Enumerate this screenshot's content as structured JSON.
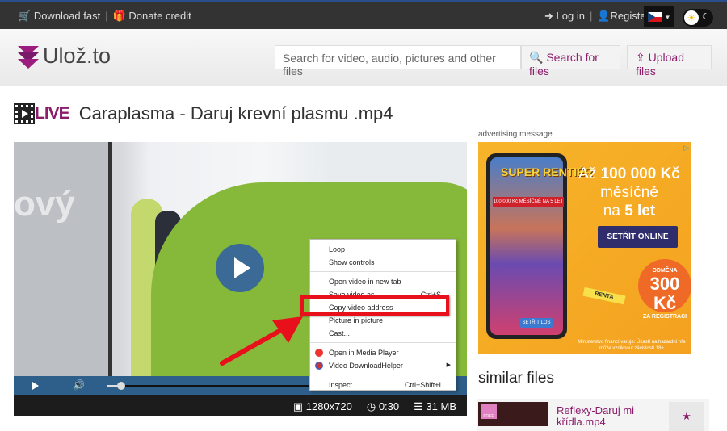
{
  "topbar": {
    "download_fast": "Download fast",
    "donate_credit": "Donate credit",
    "login": "Log in",
    "register": "Register",
    "separator": "|",
    "language": "CZ"
  },
  "header": {
    "logo_text": "Ulož.to",
    "search_placeholder": "Search for video, audio, pictures and other files",
    "search_button": "Search for files",
    "upload_button": "Upload files"
  },
  "file": {
    "badge": "LIVE",
    "title": "Caraplasma - Daruj krevní plasmu .mp4",
    "resolution": "1280x720",
    "duration": "0:30",
    "size": "31 MB",
    "progress_percent": 5
  },
  "video_overlay_text": "ový",
  "context_menu": {
    "items": [
      {
        "label": "Loop"
      },
      {
        "label": "Show controls"
      },
      {
        "label": "Open video in new tab"
      },
      {
        "label": "Save video as...",
        "shortcut": "Ctrl+S"
      },
      {
        "label": "Copy video address",
        "highlighted": true
      },
      {
        "label": "Picture in picture"
      },
      {
        "label": "Cast..."
      },
      {
        "label": "Open in Media Player"
      },
      {
        "label": "Video DownloadHelper"
      },
      {
        "label": "Inspect",
        "shortcut": "Ctrl+Shift+I"
      }
    ]
  },
  "ad": {
    "label": "advertising message",
    "brand": "SUPER RENTIÉR",
    "band": "100 000 Kč MĚSÍČNĚ NA 5 LET",
    "headline_1": "Až",
    "headline_amount": "100 000 Kč",
    "headline_2": "měsíčně",
    "headline_3": "na",
    "headline_period": "5 let",
    "cta": "SETŘÍT ONLINE",
    "badge_top": "ODMĚNA",
    "badge_amount": "300 Kč",
    "badge_bottom": "ZA REGISTRACI",
    "phone_button": "SETŘÍT LOS",
    "card_label": "RENTA",
    "warning": "Ministerstvo financí varuje: Účastí na hazardní hře může vzniknout závislost! 18+"
  },
  "similar": {
    "heading": "similar files",
    "items": [
      {
        "name": "Reflexy-Daruj mi křídla.mp4",
        "badge": "FREE"
      }
    ]
  },
  "colors": {
    "brand": "#8b1d6b",
    "highlight": "#e8101a",
    "topbar": "#333333",
    "player": "#2e5f8a"
  }
}
